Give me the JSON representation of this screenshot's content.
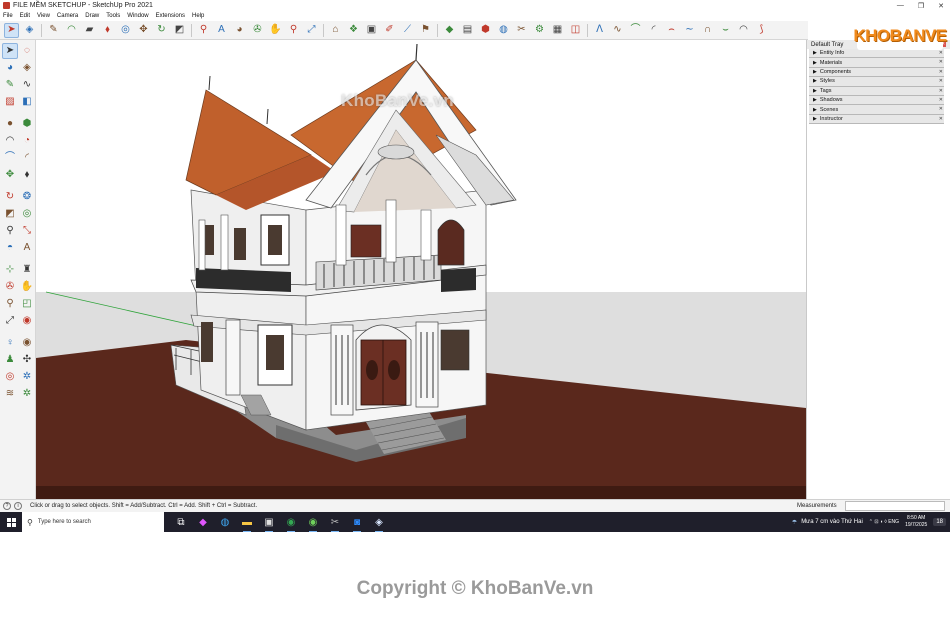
{
  "window": {
    "title": "FILE MỀM SKETCHUP - SketchUp Pro 2021",
    "controls": {
      "minimize": "—",
      "maximize": "❐",
      "close": "✕"
    }
  },
  "menu": {
    "items": [
      "File",
      "Edit",
      "View",
      "Camera",
      "Draw",
      "Tools",
      "Window",
      "Extensions",
      "Help"
    ]
  },
  "toolbar": {
    "icons": [
      {
        "name": "select-icon",
        "glyph": "➤",
        "active": true
      },
      {
        "name": "eraser-icon",
        "glyph": "◈"
      },
      {
        "name": "line-icon",
        "glyph": "✎"
      },
      {
        "name": "arc-icon",
        "glyph": "◠"
      },
      {
        "name": "shape-icon",
        "glyph": "▰"
      },
      {
        "name": "push-pull-icon",
        "glyph": "⬧"
      },
      {
        "name": "offset-icon",
        "glyph": "◎"
      },
      {
        "name": "move-icon",
        "glyph": "✥"
      },
      {
        "name": "rotate-icon",
        "glyph": "↻"
      },
      {
        "name": "scale-icon",
        "glyph": "◩"
      },
      {
        "name": "tape-measure-icon",
        "glyph": "⚲"
      },
      {
        "name": "text-icon",
        "glyph": "A"
      },
      {
        "name": "paint-bucket-icon",
        "glyph": "◕"
      },
      {
        "name": "orbit-icon",
        "glyph": "✇"
      },
      {
        "name": "pan-icon",
        "glyph": "✋"
      },
      {
        "name": "zoom-icon",
        "glyph": "⚲"
      },
      {
        "name": "zoom-extents-icon",
        "glyph": "⤢"
      },
      {
        "name": "warehouse-icon",
        "glyph": "⌂"
      },
      {
        "name": "extension-warehouse-icon",
        "glyph": "❖"
      },
      {
        "name": "layout-icon",
        "glyph": "▣"
      },
      {
        "name": "sandbox-icon",
        "glyph": "✐"
      },
      {
        "name": "follow-me-icon",
        "glyph": "⟋"
      },
      {
        "name": "section-icon",
        "glyph": "⚑"
      },
      {
        "name": "camera-icon",
        "glyph": "◆"
      },
      {
        "name": "styles-icon",
        "glyph": "▤"
      },
      {
        "name": "components-icon",
        "glyph": "⬢"
      },
      {
        "name": "materials-icon",
        "glyph": "◍"
      },
      {
        "name": "solid-tools-icon",
        "glyph": "✂"
      },
      {
        "name": "scenes-icon",
        "glyph": "⚙"
      },
      {
        "name": "outliner-icon",
        "glyph": "▦"
      },
      {
        "name": "tags-icon",
        "glyph": "◫"
      },
      {
        "name": "curve-1-icon",
        "glyph": "ᐱ"
      },
      {
        "name": "curve-2-icon",
        "glyph": "∿"
      },
      {
        "name": "curve-3-icon",
        "glyph": "⌒"
      },
      {
        "name": "curve-4-icon",
        "glyph": "◜"
      },
      {
        "name": "curve-5-icon",
        "glyph": "⌢"
      },
      {
        "name": "curve-6-icon",
        "glyph": "∼"
      },
      {
        "name": "curve-7-icon",
        "glyph": "∩"
      },
      {
        "name": "curve-8-icon",
        "glyph": "⌣"
      },
      {
        "name": "curve-9-icon",
        "glyph": "◠"
      },
      {
        "name": "curve-10-icon",
        "glyph": "⟆"
      }
    ]
  },
  "left_tools": [
    {
      "name": "select-icon",
      "glyph": "➤",
      "active": true
    },
    {
      "name": "lasso-icon",
      "glyph": "◌"
    },
    {
      "name": "paint-icon",
      "glyph": "◕"
    },
    {
      "name": "eraser-icon",
      "glyph": "◈"
    },
    {
      "name": "line-icon",
      "glyph": "✎"
    },
    {
      "name": "freehand-icon",
      "glyph": "∿"
    },
    {
      "name": "rectangle-icon",
      "glyph": "▨"
    },
    {
      "name": "rotated-rectangle-icon",
      "glyph": "◧"
    },
    {
      "name": "circle-icon",
      "glyph": "●"
    },
    {
      "name": "polygon-icon",
      "glyph": "⬢"
    },
    {
      "name": "arc-icon",
      "glyph": "◠"
    },
    {
      "name": "pie-icon",
      "glyph": "◔"
    },
    {
      "name": "three-point-arc-icon",
      "glyph": "⌒"
    },
    {
      "name": "two-point-arc-icon",
      "glyph": "◜"
    },
    {
      "name": "move-icon",
      "glyph": "✥"
    },
    {
      "name": "push-pull-icon",
      "glyph": "⬧"
    },
    {
      "name": "rotate-icon",
      "glyph": "↻"
    },
    {
      "name": "follow-me-icon",
      "glyph": "❂"
    },
    {
      "name": "scale-icon",
      "glyph": "◩"
    },
    {
      "name": "offset-icon",
      "glyph": "◎"
    },
    {
      "name": "tape-measure-icon",
      "glyph": "⚲"
    },
    {
      "name": "dimension-icon",
      "glyph": "⤡"
    },
    {
      "name": "protractor-icon",
      "glyph": "◓"
    },
    {
      "name": "text-icon",
      "glyph": "A"
    },
    {
      "name": "axes-icon",
      "glyph": "⊹"
    },
    {
      "name": "3d-text-icon",
      "glyph": "♜"
    },
    {
      "name": "orbit-icon",
      "glyph": "✇"
    },
    {
      "name": "pan-icon",
      "glyph": "✋"
    },
    {
      "name": "zoom-icon",
      "glyph": "⚲"
    },
    {
      "name": "zoom-window-icon",
      "glyph": "◰"
    },
    {
      "name": "zoom-extents-icon",
      "glyph": "⤢"
    },
    {
      "name": "previous-view-icon",
      "glyph": "◉"
    },
    {
      "name": "position-camera-icon",
      "glyph": "♀"
    },
    {
      "name": "look-around-icon",
      "glyph": "◉"
    },
    {
      "name": "walk-icon",
      "glyph": "♟"
    },
    {
      "name": "section-plane-icon",
      "glyph": "✣"
    },
    {
      "name": "warehouse-icon",
      "glyph": "◎"
    },
    {
      "name": "extension-icon",
      "glyph": "✲"
    },
    {
      "name": "layers-icon",
      "glyph": "≋"
    },
    {
      "name": "extension-manager-icon",
      "glyph": "✲"
    }
  ],
  "viewport": {
    "watermark": "KhoBanVe.vn"
  },
  "tray": {
    "title": "Default Tray",
    "panels": [
      "Entity Info",
      "Materials",
      "Components",
      "Styles",
      "Tags",
      "Shadows",
      "Scenes",
      "Instructor"
    ]
  },
  "brand": {
    "logo_text": "KHOBANVE"
  },
  "status": {
    "hint": "Click or drag to select objects. Shift = Add/Subtract. Ctrl = Add. Shift + Ctrl = Subtract.",
    "measurements_label": "Measurements",
    "measurements_value": ""
  },
  "taskbar": {
    "search_placeholder": "Type here to search",
    "apps": [
      {
        "name": "task-view-icon",
        "glyph": "⧉",
        "color": "#ffffff"
      },
      {
        "name": "copilot-icon",
        "glyph": "◆",
        "color": "#e056fd"
      },
      {
        "name": "edge-icon",
        "glyph": "◍",
        "color": "#3fa9f5"
      },
      {
        "name": "file-explorer-icon",
        "glyph": "▬",
        "color": "#f6c544"
      },
      {
        "name": "store-icon",
        "glyph": "▣",
        "color": "#e0e0e0"
      },
      {
        "name": "chrome-icon",
        "glyph": "◉",
        "color": "#34a853"
      },
      {
        "name": "coccoc-icon",
        "glyph": "◉",
        "color": "#6fcf5b"
      },
      {
        "name": "app-icon",
        "glyph": "✂",
        "color": "#bbbbbb"
      },
      {
        "name": "zalo-icon",
        "glyph": "◙",
        "color": "#2d8cff"
      },
      {
        "name": "sketchup-icon",
        "glyph": "◈",
        "color": "#d8e6ff"
      }
    ],
    "weather": "Mưa 7 cm vào Thứ Hai",
    "system_icons": "⌃ ⊡ ◖ ◊ ENG",
    "time": "8:50 AM",
    "date": "19/7/2025",
    "notification_count": "18"
  },
  "footer": {
    "copyright": "Copyright © KhoBanVe.vn"
  },
  "colors": {
    "ground": "#5a281c",
    "sky": "#dedede",
    "roof": "#c0602c",
    "wall": "#f4f4f4",
    "door": "#6b2f23",
    "brand_orange": "#f08a1c"
  }
}
